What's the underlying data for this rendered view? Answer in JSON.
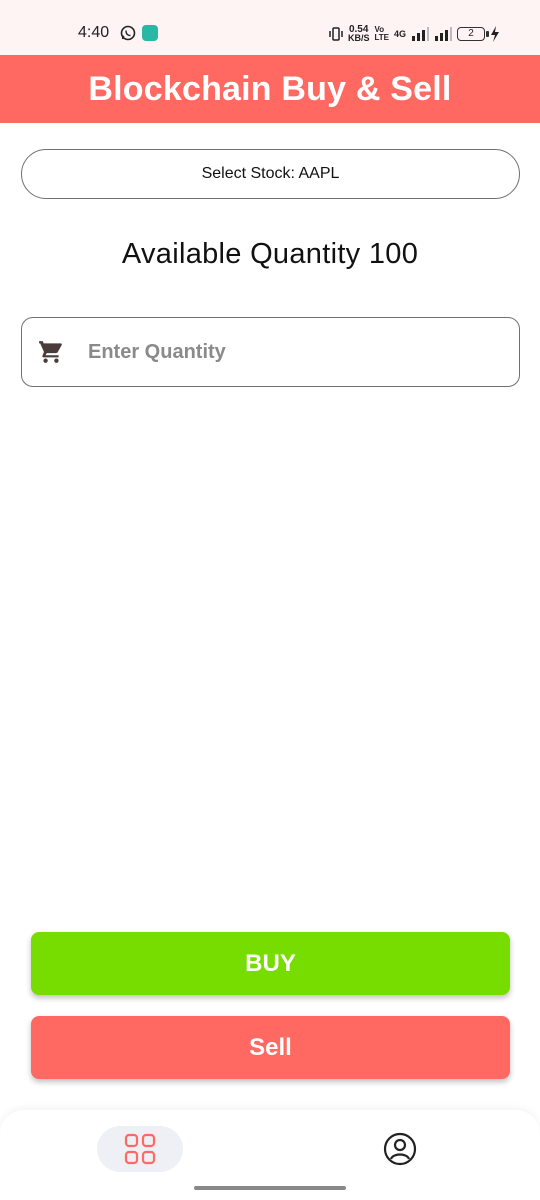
{
  "status_bar": {
    "time": "4:40",
    "net_speed_value": "0.54",
    "net_speed_unit": "KB/S",
    "volte_top": "Vo",
    "volte_bottom": "LTE",
    "network": "4G",
    "battery_level": "2",
    "icons": [
      "whatsapp-icon",
      "message-icon",
      "vibrate-icon",
      "signal-icon",
      "battery-icon",
      "charging-icon"
    ]
  },
  "header": {
    "title": "Blockchain Buy & Sell",
    "background_color": "#ff6961"
  },
  "stock_selector": {
    "label": "Select Stock: AAPL"
  },
  "availability": {
    "text": "Available Quantity 100"
  },
  "quantity_input": {
    "placeholder": "Enter Quantity",
    "value": "",
    "icon": "cart-icon"
  },
  "actions": {
    "buy_label": "BUY",
    "buy_color": "#77dd00",
    "sell_label": "Sell",
    "sell_color": "#ff6961"
  },
  "bottom_nav": {
    "items": [
      {
        "name": "home",
        "icon": "grid-icon",
        "active": true
      },
      {
        "name": "profile",
        "icon": "profile-icon",
        "active": false
      }
    ]
  }
}
